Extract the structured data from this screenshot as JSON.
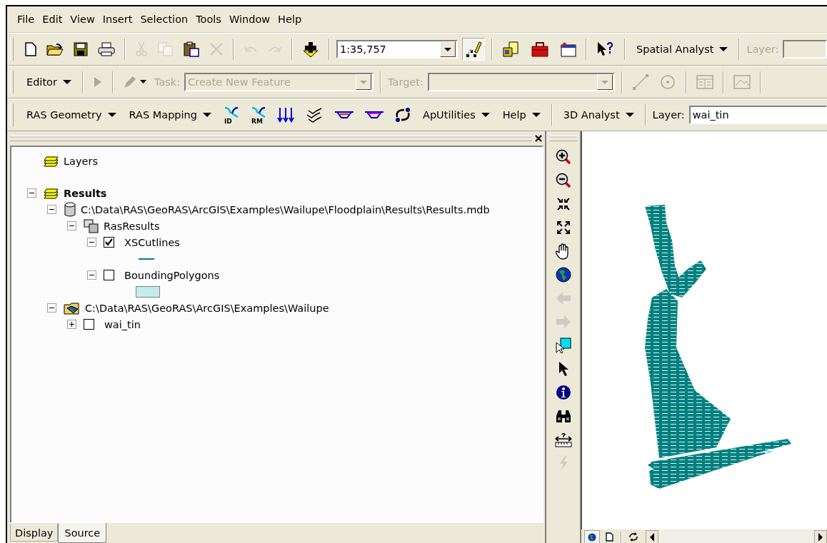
{
  "menu": [
    "File",
    "Edit",
    "View",
    "Insert",
    "Selection",
    "Tools",
    "Window",
    "Help"
  ],
  "standard_toolbar": {
    "buttons": [
      {
        "kind": "new",
        "disabled": false
      },
      {
        "kind": "open",
        "disabled": false
      },
      {
        "kind": "save",
        "disabled": false
      },
      {
        "kind": "print",
        "disabled": false
      },
      {
        "kind": "sep"
      },
      {
        "kind": "cut",
        "disabled": true
      },
      {
        "kind": "copy",
        "disabled": true
      },
      {
        "kind": "paste",
        "disabled": false
      },
      {
        "kind": "delete",
        "disabled": true
      },
      {
        "kind": "sep"
      },
      {
        "kind": "undo",
        "disabled": true
      },
      {
        "kind": "redo",
        "disabled": true
      },
      {
        "kind": "sep"
      },
      {
        "kind": "add-data",
        "disabled": false
      }
    ],
    "scale": "1:35,757",
    "tools": [
      {
        "kind": "editor-toolbar",
        "pressed": true
      },
      {
        "kind": "sep"
      },
      {
        "kind": "catalog",
        "pressed": false
      },
      {
        "kind": "toolbox",
        "pressed": false
      },
      {
        "kind": "command",
        "pressed": false
      },
      {
        "kind": "sep"
      },
      {
        "kind": "whats-this",
        "pressed": false
      }
    ],
    "menu_button": "Spatial Analyst",
    "layer_label": "Layer:",
    "layer_disabled": true
  },
  "editor_toolbar": {
    "menu_button": "Editor",
    "task_label": "Task:",
    "task_value": "Create New Feature",
    "target_label": "Target:",
    "disabled": true
  },
  "ras_toolbar": {
    "menus": [
      "RAS Geometry",
      "RAS Mapping"
    ],
    "tools": [
      {
        "kind": "cutline",
        "tag": "ID"
      },
      {
        "kind": "cutline",
        "tag": "RM"
      },
      {
        "kind": "flowpaths"
      },
      {
        "kind": "layers"
      },
      {
        "kind": "bank"
      },
      {
        "kind": "levee"
      },
      {
        "kind": "convert"
      }
    ],
    "menus_after": [
      "ApUtilities",
      "Help"
    ],
    "analyst_menu": "3D Analyst",
    "layer_label": "Layer:",
    "layer_value": "wai_tin"
  },
  "toc": [
    {
      "kind": "frame",
      "label": "Layers",
      "active": false
    },
    {
      "kind": "frame",
      "label": "Results",
      "active": true,
      "expanded": true,
      "children": [
        {
          "kind": "database",
          "label": "C:\\Data\\RAS\\GeoRAS\\ArcGIS\\Examples\\Wailupe\\Floodplain\\Results\\Results.mdb",
          "expanded": true,
          "children": [
            {
              "kind": "dataset",
              "label": "RasResults",
              "expanded": true,
              "children": [
                {
                  "kind": "layer",
                  "label": "XSCutlines",
                  "expanded": true,
                  "checked": true,
                  "legend": {
                    "kind": "line"
                  }
                },
                {
                  "kind": "layer",
                  "label": "BoundingPolygons",
                  "expanded": true,
                  "checked": false,
                  "legend": {
                    "kind": "fill"
                  }
                }
              ]
            }
          ]
        },
        {
          "kind": "folder",
          "label": "C:\\Data\\RAS\\GeoRAS\\ArcGIS\\Examples\\Wailupe",
          "expanded": true,
          "children": [
            {
              "kind": "layer",
              "label": "wai_tin",
              "expanded": false,
              "checked": false
            }
          ]
        }
      ]
    }
  ],
  "toc_tabs": [
    {
      "label": "Display",
      "selected": false
    },
    {
      "label": "Source",
      "selected": true
    }
  ],
  "map_tools": [
    {
      "kind": "zoom-in",
      "disabled": false
    },
    {
      "kind": "zoom-out",
      "disabled": false
    },
    {
      "kind": "fixed-in",
      "disabled": false
    },
    {
      "kind": "fixed-out",
      "disabled": false
    },
    {
      "kind": "pan",
      "disabled": false
    },
    {
      "kind": "globe",
      "disabled": false
    },
    {
      "kind": "back",
      "disabled": true
    },
    {
      "kind": "forward",
      "disabled": true
    },
    {
      "kind": "select-elements",
      "disabled": false
    },
    {
      "kind": "pointer",
      "disabled": false
    },
    {
      "kind": "identify",
      "disabled": false
    },
    {
      "kind": "find",
      "disabled": false
    },
    {
      "kind": "measure",
      "disabled": false
    },
    {
      "kind": "hyperlink",
      "disabled": true
    }
  ],
  "view_buttons": [
    {
      "kind": "data-view",
      "selected": true
    },
    {
      "kind": "layout-view",
      "selected": false
    }
  ]
}
